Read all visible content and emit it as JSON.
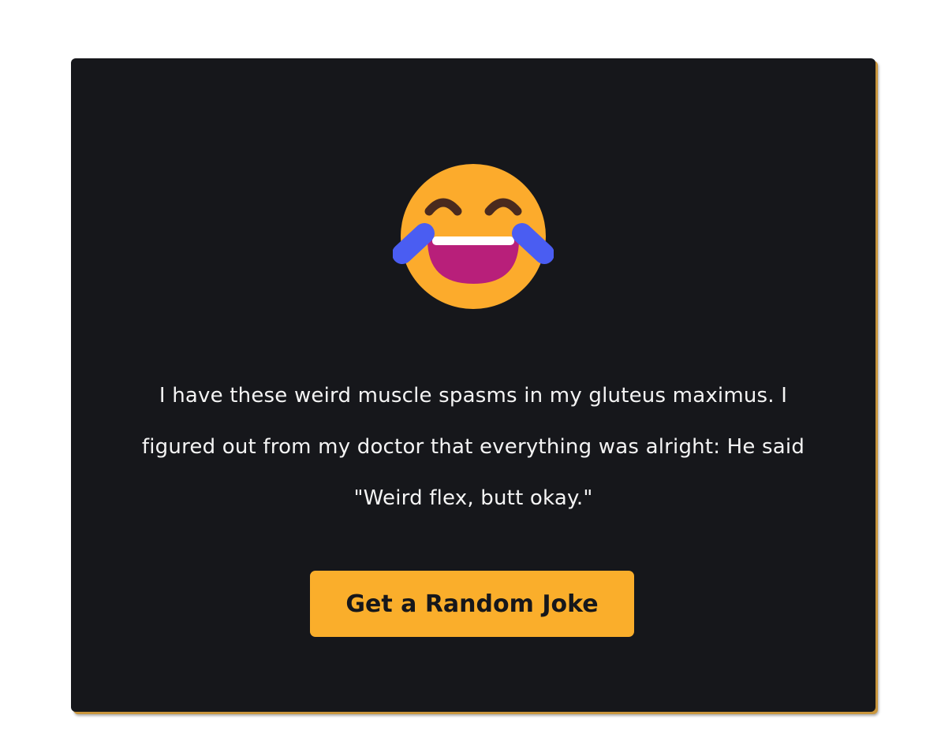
{
  "joke": {
    "text": "I have these weird muscle spasms in my gluteus maximus. I figured out from my doctor that everything was alright: He said \"Weird flex, butt okay.\""
  },
  "button": {
    "label": "Get a Random Joke"
  },
  "emoji": {
    "icon": "laughing-tears-emoji-icon"
  },
  "colors": {
    "background": "#ffffff",
    "card": "#16171b",
    "accent": "#faae2b",
    "text": "#f4f4f4",
    "button_text": "#16171b"
  }
}
